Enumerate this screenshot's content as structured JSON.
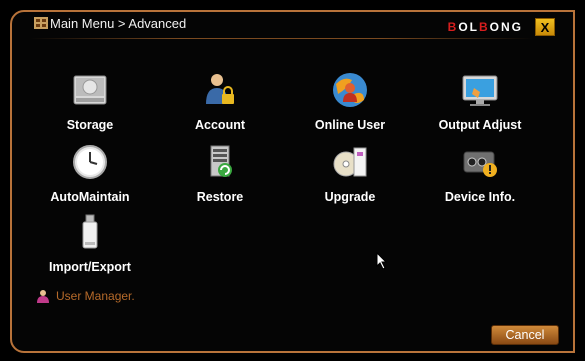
{
  "window": {
    "breadcrumb": "Main Menu > Advanced",
    "brand": {
      "part1": "B",
      "part2": "OL",
      "part3": "B",
      "part4": "ONG"
    },
    "close_label": "X"
  },
  "menu": {
    "items": [
      {
        "label": "Storage",
        "icon": "hard-drive-icon"
      },
      {
        "label": "Account",
        "icon": "user-lock-icon"
      },
      {
        "label": "Online User",
        "icon": "online-user-icon"
      },
      {
        "label": "Output Adjust",
        "icon": "monitor-icon"
      },
      {
        "label": "AutoMaintain",
        "icon": "clock-icon"
      },
      {
        "label": "Restore",
        "icon": "restore-icon"
      },
      {
        "label": "Upgrade",
        "icon": "upgrade-disc-icon"
      },
      {
        "label": "Device Info.",
        "icon": "device-info-icon"
      },
      {
        "label": "Import/Export",
        "icon": "usb-drive-icon"
      }
    ]
  },
  "user_manager": {
    "label": "User Manager."
  },
  "footer": {
    "cancel_label": "Cancel"
  },
  "colors": {
    "accent": "#b8733a",
    "background": "#000000",
    "text": "#ffffff"
  }
}
